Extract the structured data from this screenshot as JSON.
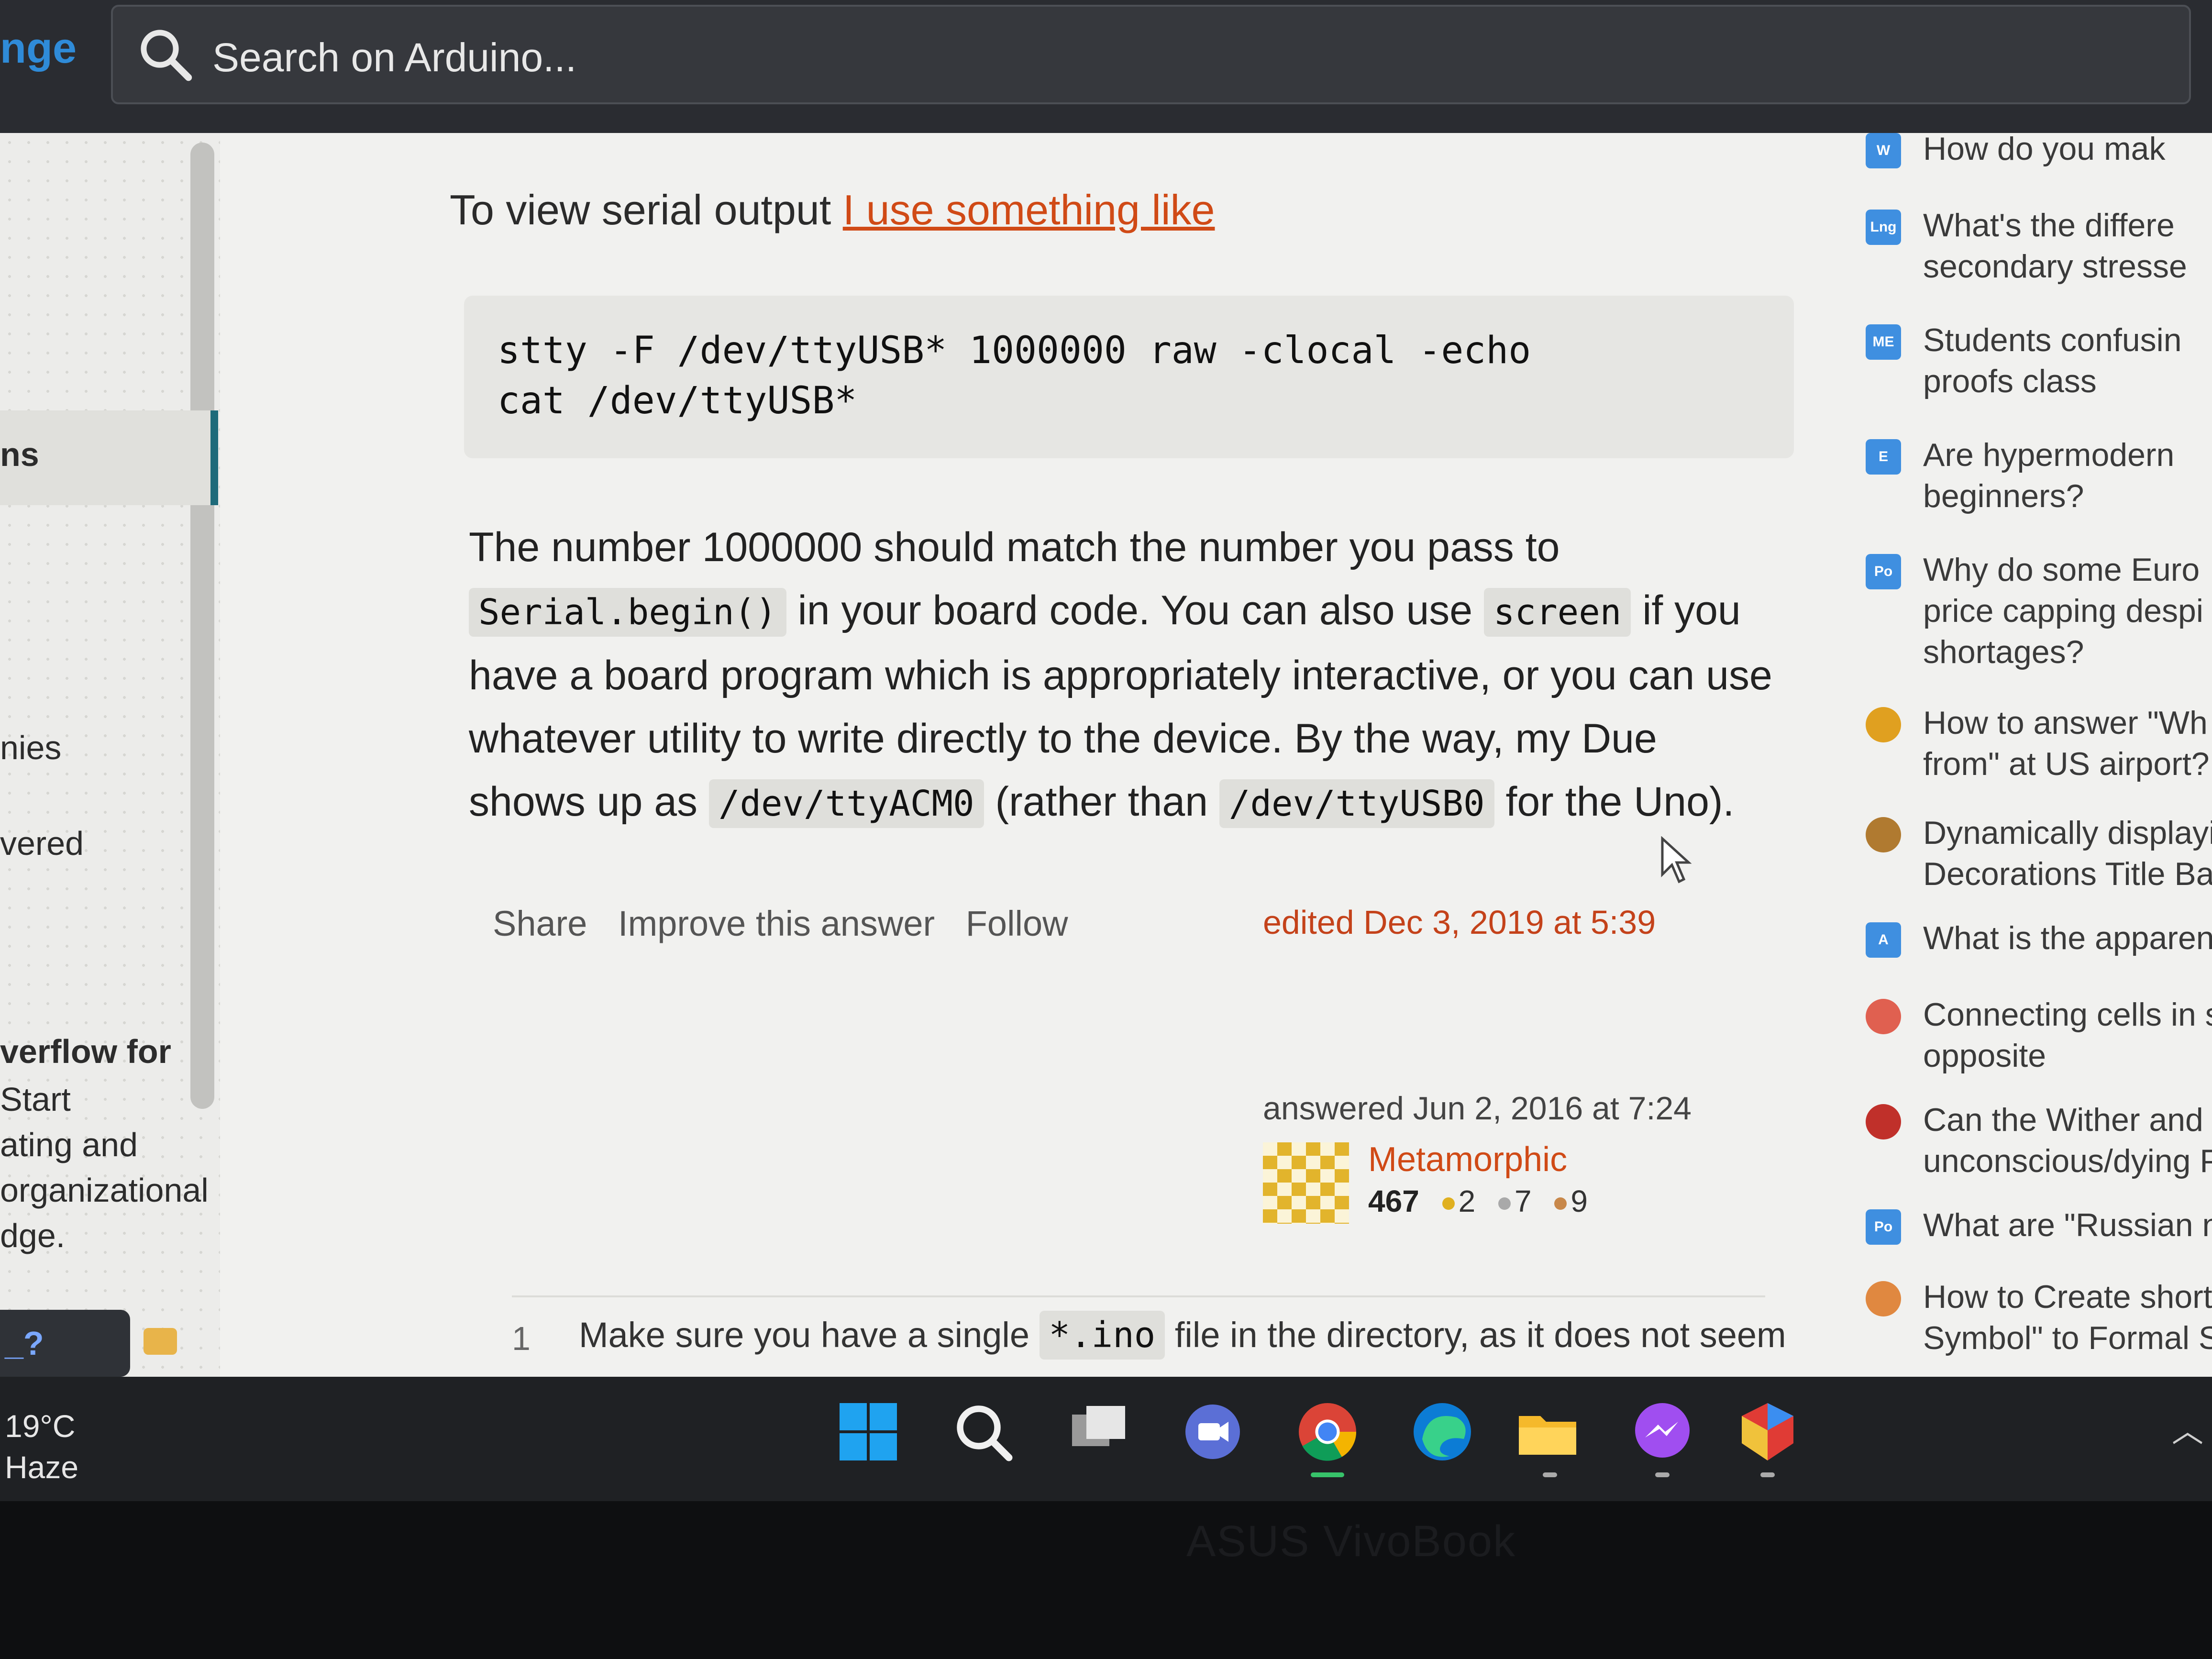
{
  "topbar": {
    "site_fragment": "nge",
    "search_placeholder": "Search on Arduino..."
  },
  "left_sidebar": {
    "items": [
      "ns",
      "nies",
      "vered"
    ],
    "promo_lines": [
      "verflow for",
      " Start",
      "ating and",
      "organizational",
      "dge."
    ],
    "chat_label": "_?"
  },
  "answer": {
    "intro_text": "To view serial output ",
    "intro_link": "I use something like",
    "code_lines": [
      "stty -F /dev/ttyUSB* 1000000 raw -clocal -echo",
      "cat /dev/ttyUSB*"
    ],
    "para": {
      "l1": "The number 1000000 should match the number you pass to",
      "c1": "Serial.begin()",
      "l2a": " in your board code. You can also use ",
      "c2": "screen",
      "l2b": " if you",
      "l3": "have a board program which is appropriately interactive, or you can use",
      "l4": "whatever utility to write directly to the device. By the way, my Due",
      "l5a": "shows up as ",
      "c3": "/dev/ttyACM0",
      "l5b": " (rather than ",
      "c4": "/dev/ttyUSB0",
      "l5c": " for the Uno)."
    },
    "actions": [
      "Share",
      "Improve this answer",
      "Follow"
    ],
    "edited": "edited Dec 3, 2019 at 5:39",
    "answered": "answered Jun 2, 2016 at 7:24",
    "user": {
      "name": "Metamorphic",
      "reputation": "467",
      "gold": "2",
      "silver": "7",
      "bronze": "9"
    },
    "comment": {
      "score": "1",
      "text_a": "Make sure you have a single ",
      "code": "*.ino",
      "text_b": " file in the directory, as it does not seem"
    }
  },
  "hot_questions": [
    {
      "icon": "W",
      "line1": "How do you mak",
      "line2": "",
      "color": "#3f8fe0"
    },
    {
      "icon": "Lng",
      "line1": "What's the differe",
      "line2": "secondary stresse",
      "color": "#3f8fe0"
    },
    {
      "icon": "ME",
      "line1": "Students confusin",
      "line2": "proofs class",
      "color": "#3f8fe0"
    },
    {
      "icon": "E",
      "line1": "Are hypermodern",
      "line2": "beginners?",
      "color": "#3f8fe0"
    },
    {
      "icon": "Po",
      "line1": "Why do some Euro",
      "line2": "price capping despi",
      "line3": "shortages?",
      "color": "#3f8fe0"
    },
    {
      "icon": "",
      "line1": "How to answer \"Wh",
      "line2": "from\" at US airport?",
      "color": "#e0a020"
    },
    {
      "icon": "",
      "line1": "Dynamically displayi",
      "line2": "Decorations Title Bar",
      "color": "#b07a30"
    },
    {
      "icon": "A",
      "line1": "What is the apparent",
      "line2": "",
      "color": "#3f8fe0"
    },
    {
      "icon": "",
      "line1": "Connecting cells in se",
      "line2": "opposite",
      "color": "#e06050"
    },
    {
      "icon": "",
      "line1": "Can the Wither and Bl",
      "line2": "unconscious/dying PC",
      "color": "#c0302a"
    },
    {
      "icon": "Po",
      "line1": "What are \"Russian natio",
      "line2": "",
      "color": "#3f8fe0"
    },
    {
      "icon": "",
      "line1": "How to Create short-cu",
      "line2": "Symbol\" to Formal Symb",
      "color": "#e08840"
    }
  ],
  "taskbar": {
    "temperature": "19°C",
    "condition": "Haze"
  },
  "device_brand": "ASUS VivoBook"
}
